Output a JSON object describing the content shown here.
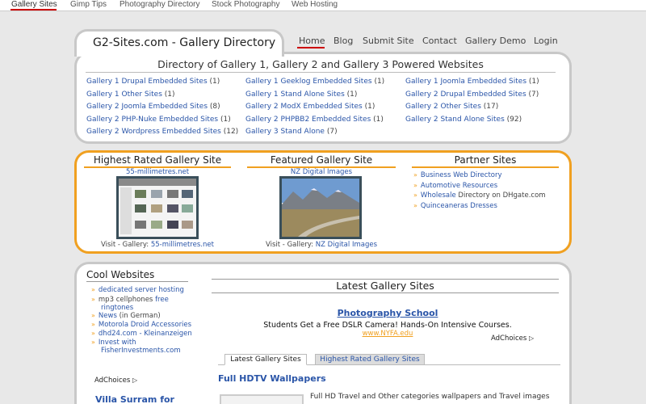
{
  "topnav": {
    "items": [
      "Gallery Sites",
      "Gimp Tips",
      "Photography Directory",
      "Stock Photography",
      "Web Hosting"
    ]
  },
  "header": {
    "title": "G2-Sites.com - Gallery Directory",
    "nav": [
      "Home",
      "Blog",
      "Submit Site",
      "Contact",
      "Gallery Demo",
      "Login"
    ]
  },
  "directory": {
    "title": "Directory of Gallery 1, Gallery 2 and Gallery 3 Powered Websites",
    "items": [
      {
        "label": "Gallery 1 Drupal Embedded Sites",
        "count": "(1)"
      },
      {
        "label": "Gallery 1 Geeklog Embedded Sites",
        "count": "(1)"
      },
      {
        "label": "Gallery 1 Joomla Embedded Sites",
        "count": "(1)"
      },
      {
        "label": "Gallery 1 Other Sites",
        "count": "(1)"
      },
      {
        "label": "Gallery 1 Stand Alone Sites",
        "count": "(1)"
      },
      {
        "label": "Gallery 2 Drupal Embedded Sites",
        "count": "(7)"
      },
      {
        "label": "Gallery 2 Joomla Embedded Sites",
        "count": "(8)"
      },
      {
        "label": "Gallery 2 ModX Embedded Sites",
        "count": "(1)"
      },
      {
        "label": "Gallery 2 Other Sites",
        "count": "(17)"
      },
      {
        "label": "Gallery 2 PHP-Nuke Embedded Sites",
        "count": "(1)"
      },
      {
        "label": "Gallery 2 PHPBB2 Embedded Sites",
        "count": "(1)"
      },
      {
        "label": "Gallery 2 Stand Alone Sites",
        "count": "(92)"
      },
      {
        "label": "Gallery 2 Wordpress Embedded Sites",
        "count": "(12)"
      },
      {
        "label": "Gallery 3 Stand Alone",
        "count": "(7)"
      }
    ]
  },
  "featured": {
    "highest": {
      "title": "Highest Rated Gallery Site",
      "site": "55-millimetres.net",
      "visit_prefix": "Visit - Gallery: ",
      "visit_site": "55-millimetres.net"
    },
    "featured": {
      "title": "Featured Gallery Site",
      "site": "NZ Digital Images",
      "visit_prefix": "Visit - Gallery: ",
      "visit_site": "NZ Digital Images"
    },
    "partners": {
      "title": "Partner Sites",
      "items": [
        {
          "link": "Business Web Directory",
          "rest": ""
        },
        {
          "link": "Automotive Resources",
          "rest": ""
        },
        {
          "link": "Wholesale",
          "rest": " Directory on DHgate.com"
        },
        {
          "link": "Quinceaneras Dresses",
          "rest": ""
        }
      ]
    }
  },
  "cool": {
    "title": "Cool Websites",
    "items": [
      {
        "lines": [
          {
            "link": "dedicated server hosting",
            "rest": ""
          }
        ]
      },
      {
        "lines": [
          {
            "link": "",
            "rest": "mp3 cellphones "
          },
          {
            "link": "free",
            "rest": ""
          }
        ],
        "line2": "ringtones"
      },
      {
        "lines": [
          {
            "link": "News",
            "rest": " (in German)"
          }
        ]
      },
      {
        "lines": [
          {
            "link": "Motorola Droid Accessories",
            "rest": ""
          }
        ]
      },
      {
        "lines": [
          {
            "link": "dhd24.com - Kleinanzeigen",
            "rest": ""
          }
        ]
      },
      {
        "lines": [
          {
            "link": "Invest with",
            "rest": ""
          }
        ],
        "line2": "FisherInvestments.com"
      }
    ],
    "adchoices": "AdChoices",
    "villa": "Villa Surram for"
  },
  "latest": {
    "title": "Latest Gallery Sites",
    "ad": {
      "title": "Photography School",
      "text": "Students Get a Free DSLR Camera! Hands-On Intensive Courses.",
      "url": "www.NYFA.edu",
      "adchoices": "AdChoices"
    },
    "tabs": [
      "Latest Gallery Sites",
      "Highest Rated Gallery Sites"
    ],
    "entry_title": "Full HDTV Wallpapers",
    "entry_text": "Full HD Travel and Other categories wallpapers and Travel images"
  },
  "colors": {
    "accent_orange": "#f0a020",
    "link_blue": "#2a55a8",
    "active_red": "#cc0000"
  }
}
